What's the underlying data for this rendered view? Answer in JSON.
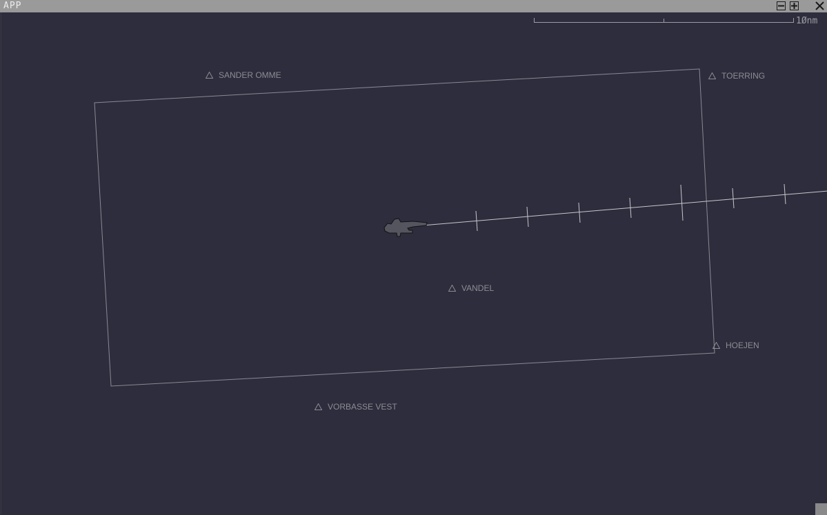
{
  "window": {
    "title": "APP",
    "background_color": "#2e2d3d",
    "controls": [
      {
        "name": "minimize",
        "icon": "minus-box-icon"
      },
      {
        "name": "maximize",
        "icon": "plus-box-icon"
      },
      {
        "name": "close",
        "icon": "x-icon"
      }
    ]
  },
  "scale_bar": {
    "label": "1Ønm",
    "color": "#9c9ca4"
  },
  "fixes": [
    {
      "name": "SANDER OMME"
    },
    {
      "name": "TOERRING"
    },
    {
      "name": "VANDEL"
    },
    {
      "name": "HOEJEN"
    },
    {
      "name": "VORBASSE VEST"
    }
  ],
  "airspace_boundary": {
    "color": "#8a8a94"
  },
  "aircraft": {
    "icon": "aircraft-silhouette-icon",
    "track_line_color": "#c8c8cc"
  }
}
